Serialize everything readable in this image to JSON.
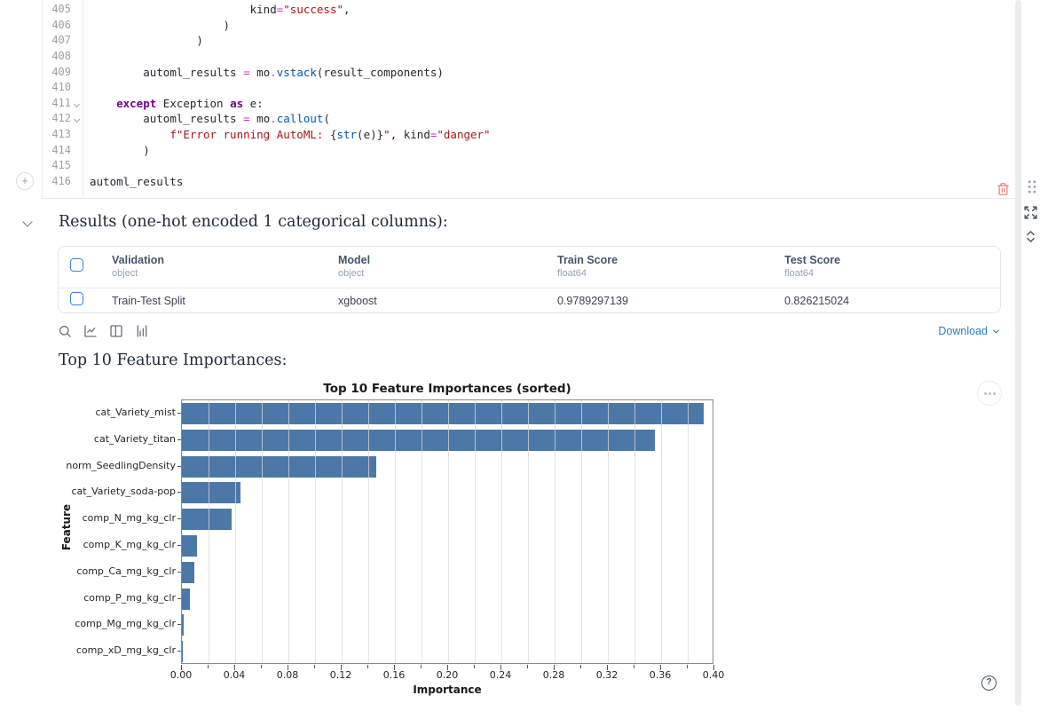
{
  "editor": {
    "lines": [
      {
        "n": "405",
        "fold": false,
        "indent": 24,
        "tokens": [
          [
            "kind",
            "n"
          ],
          [
            "=",
            "o"
          ],
          [
            "\"success\"",
            "s"
          ],
          [
            ",",
            "n"
          ]
        ]
      },
      {
        "n": "406",
        "fold": false,
        "indent": 20,
        "tokens": [
          [
            ")",
            "n"
          ]
        ]
      },
      {
        "n": "407",
        "fold": false,
        "indent": 16,
        "tokens": [
          [
            ")",
            "n"
          ]
        ]
      },
      {
        "n": "408",
        "fold": false,
        "indent": 0,
        "tokens": []
      },
      {
        "n": "409",
        "fold": false,
        "indent": 8,
        "tokens": [
          [
            "automl_results ",
            "n"
          ],
          [
            "=",
            "o"
          ],
          [
            " mo",
            "n"
          ],
          [
            ".",
            "o"
          ],
          [
            "vstack",
            "f"
          ],
          [
            "(result_components)",
            "n"
          ]
        ]
      },
      {
        "n": "410",
        "fold": false,
        "indent": 0,
        "tokens": []
      },
      {
        "n": "411",
        "fold": true,
        "indent": 4,
        "tokens": [
          [
            "except",
            "k"
          ],
          [
            " Exception ",
            "n"
          ],
          [
            "as",
            "k"
          ],
          [
            " e:",
            "n"
          ]
        ]
      },
      {
        "n": "412",
        "fold": true,
        "indent": 8,
        "tokens": [
          [
            "automl_results ",
            "n"
          ],
          [
            "=",
            "o"
          ],
          [
            " mo",
            "n"
          ],
          [
            ".",
            "o"
          ],
          [
            "callout",
            "f"
          ],
          [
            "(",
            "n"
          ]
        ]
      },
      {
        "n": "413",
        "fold": false,
        "indent": 12,
        "tokens": [
          [
            "f\"Error running AutoML: ",
            "s"
          ],
          [
            "{",
            "n"
          ],
          [
            "str",
            "f"
          ],
          [
            "(e)}",
            "n"
          ],
          [
            "\"",
            "s"
          ],
          [
            ", kind",
            "n"
          ],
          [
            "=",
            "o"
          ],
          [
            "\"danger\"",
            "s"
          ]
        ]
      },
      {
        "n": "414",
        "fold": false,
        "indent": 8,
        "tokens": [
          [
            ")",
            "n"
          ]
        ]
      },
      {
        "n": "415",
        "fold": false,
        "indent": 0,
        "tokens": []
      },
      {
        "n": "416",
        "fold": false,
        "indent": 0,
        "tokens": [
          [
            "automl_results",
            "n"
          ]
        ]
      }
    ]
  },
  "results": {
    "heading": "Results (one-hot encoded 1 categorical columns):",
    "table": {
      "columns": [
        {
          "label": "Validation",
          "dtype": "object"
        },
        {
          "label": "Model",
          "dtype": "object"
        },
        {
          "label": "Train Score",
          "dtype": "float64"
        },
        {
          "label": "Test Score",
          "dtype": "float64"
        }
      ],
      "rows": [
        [
          "Train-Test Split",
          "xgboost",
          "0.9789297139",
          "0.826215024"
        ]
      ]
    },
    "toolbar": {
      "download_label": "Download"
    }
  },
  "importances": {
    "heading": "Top 10 Feature Importances:"
  },
  "chart_data": {
    "type": "bar",
    "orientation": "horizontal",
    "title": "Top 10 Feature Importances (sorted)",
    "xlabel": "Importance",
    "ylabel": "Feature",
    "categories": [
      "cat_Variety_mist",
      "cat_Variety_titan",
      "norm_SeedlingDensity",
      "cat_Variety_soda-pop",
      "comp_N_mg_kg_clr",
      "comp_K_mg_kg_clr",
      "comp_Ca_mg_kg_clr",
      "comp_P_mg_kg_clr",
      "comp_Mg_mg_kg_clr",
      "comp_xD_mg_kg_clr"
    ],
    "values": [
      0.392,
      0.355,
      0.146,
      0.044,
      0.037,
      0.011,
      0.009,
      0.006,
      0.001,
      0.0005
    ],
    "xlim": [
      0,
      0.4
    ],
    "xticks": [
      "0.00",
      "0.04",
      "0.08",
      "0.12",
      "0.16",
      "0.20",
      "0.24",
      "0.28",
      "0.32",
      "0.36",
      "0.40"
    ],
    "grid": "vertical, every 0.02",
    "legend": "none",
    "bar_color": "#4c78a8"
  },
  "colors": {
    "keyword": "#770088",
    "string": "#a91616",
    "function": "#0057aa",
    "operator": "#c13ac1",
    "checkbox_accent": "#3b82f6",
    "link_blue": "#2d7cc1",
    "delete_red": "#f47c7c"
  },
  "icons": [
    "add-cell-plus",
    "collapse-chevron",
    "trash",
    "drag-handle",
    "expand",
    "chevrons-up-down",
    "search",
    "line-chart",
    "columns",
    "bar-chart",
    "download-chevron",
    "ellipsis-menu",
    "help-question"
  ]
}
